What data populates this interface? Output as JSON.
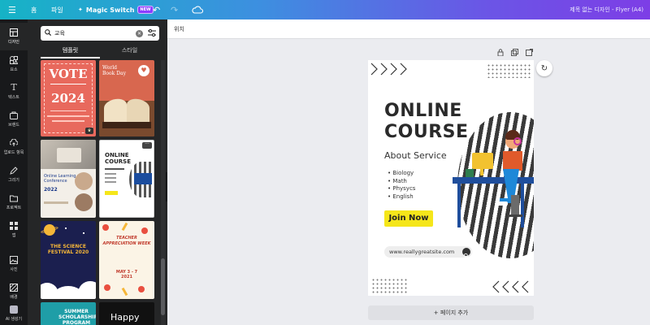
{
  "topbar": {
    "menu_icon": "hamburger-icon",
    "home_label": "홈",
    "file_label": "파일",
    "magic_switch_label": "Magic Switch",
    "new_badge": "NEW",
    "undo_icon": "undo-icon",
    "redo_icon": "redo-icon",
    "cloud_icon": "cloud-icon",
    "doc_title": "제목 없는 디자인 - Flyer (A4)"
  },
  "left_rail": [
    {
      "label": "디자인",
      "icon": "layout-icon",
      "active": true
    },
    {
      "label": "요소",
      "icon": "shapes-icon"
    },
    {
      "label": "텍스트",
      "icon": "text-icon"
    },
    {
      "label": "브랜드",
      "icon": "brand-icon"
    },
    {
      "label": "업로드 항목",
      "icon": "upload-icon"
    },
    {
      "label": "그리기",
      "icon": "draw-icon"
    },
    {
      "label": "프로젝트",
      "icon": "folder-icon"
    },
    {
      "label": "앱",
      "icon": "apps-icon"
    },
    {
      "label": "사진",
      "icon": "photo-icon"
    },
    {
      "label": "배경",
      "icon": "background-icon"
    },
    {
      "label": "AI 생성기",
      "icon": "ai-icon"
    }
  ],
  "panel": {
    "search_value": "교육",
    "tabs": [
      "템플릿",
      "스타일"
    ],
    "templates": [
      {
        "name": "vote",
        "title": "VOTE",
        "year": "2024"
      },
      {
        "name": "world-book-day",
        "title": "World Book Day"
      },
      {
        "name": "online-learning",
        "title": "Online Learning Conference",
        "year": "2022"
      },
      {
        "name": "online-course-mini",
        "title": "ONLINE COURSE"
      },
      {
        "name": "science-festival",
        "title": "THE SCIENCE FESTIVAL 2020"
      },
      {
        "name": "teacher-appreciation",
        "title": "TEACHER APPRECIATION WEEK",
        "date": "MAY 3 - 7 2021"
      },
      {
        "name": "summer-scholarship",
        "title": "SUMMER SCHOLARSHIP PROGRAM"
      },
      {
        "name": "happy",
        "title": "Happy"
      }
    ]
  },
  "canvas": {
    "position_label": "위치",
    "add_page_label": "+ 페이지 추가",
    "flyer": {
      "title_line1": "ONLINE",
      "title_line2": "COURSE",
      "subtitle": "About Service",
      "bullets": [
        "Biology",
        "Math",
        "Physycs",
        "English"
      ],
      "cta": "Join Now",
      "url": "www.reallygreatsite.com"
    }
  },
  "colors": {
    "accent_yellow": "#f5e61a",
    "rail_bg": "#18191b",
    "panel_bg": "#252627"
  }
}
